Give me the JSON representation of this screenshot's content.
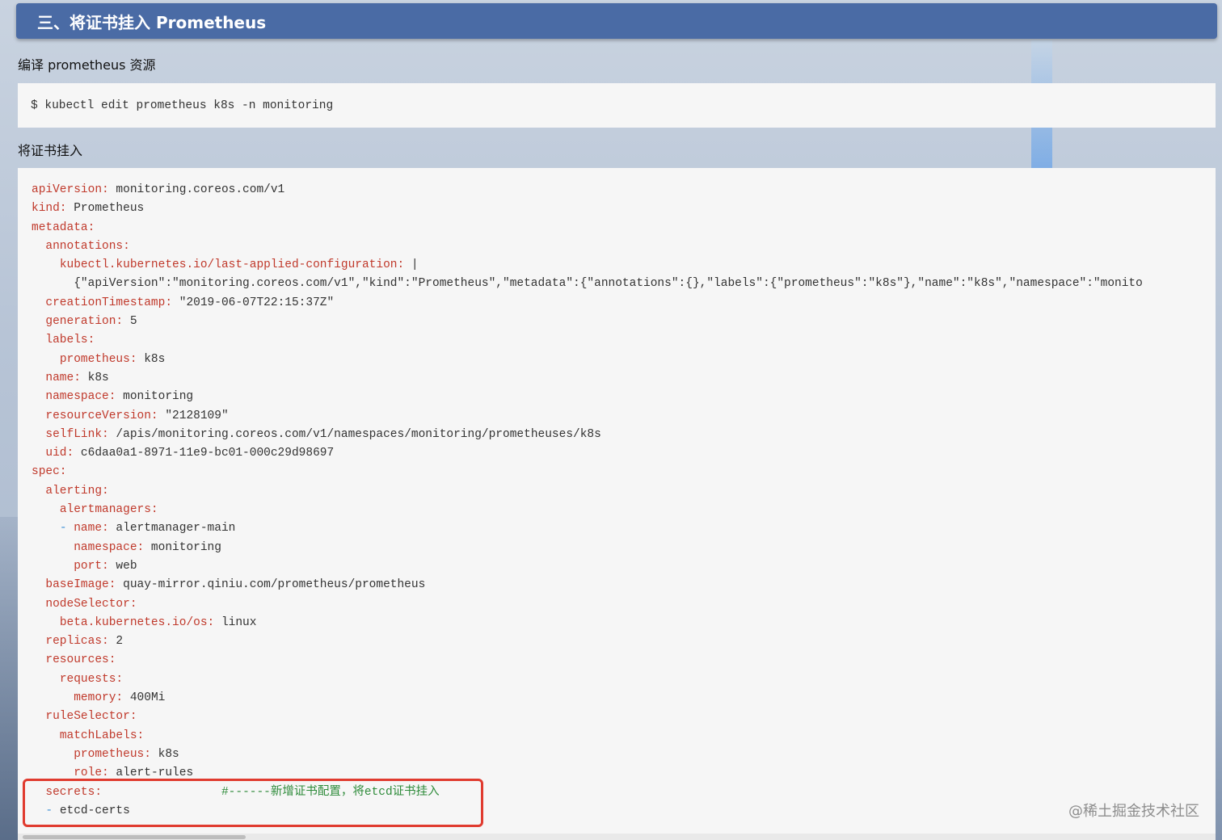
{
  "header": {
    "title": "三、将证书挂入 Prometheus"
  },
  "paragraph1": "编译 prometheus 资源",
  "command": "$ kubectl edit prometheus k8s -n monitoring",
  "paragraph2": "将证书挂入",
  "code_lines": [
    {
      "indent": "",
      "dash": "",
      "key": "apiVersion:",
      "value": " monitoring.coreos.com/v1",
      "comment": ""
    },
    {
      "indent": "",
      "dash": "",
      "key": "kind:",
      "value": " Prometheus",
      "comment": ""
    },
    {
      "indent": "",
      "dash": "",
      "key": "metadata:",
      "value": "",
      "comment": ""
    },
    {
      "indent": "  ",
      "dash": "",
      "key": "annotations:",
      "value": "",
      "comment": ""
    },
    {
      "indent": "    ",
      "dash": "",
      "key": "kubectl.kubernetes.io/last-applied-configuration:",
      "value": " |",
      "comment": ""
    },
    {
      "indent": "      ",
      "dash": "",
      "key": "",
      "value": "{\"apiVersion\":\"monitoring.coreos.com/v1\",\"kind\":\"Prometheus\",\"metadata\":{\"annotations\":{},\"labels\":{\"prometheus\":\"k8s\"},\"name\":\"k8s\",\"namespace\":\"monito",
      "comment": ""
    },
    {
      "indent": "  ",
      "dash": "",
      "key": "creationTimestamp:",
      "value": " \"2019-06-07T22:15:37Z\"",
      "comment": ""
    },
    {
      "indent": "  ",
      "dash": "",
      "key": "generation:",
      "value": " 5",
      "comment": ""
    },
    {
      "indent": "  ",
      "dash": "",
      "key": "labels:",
      "value": "",
      "comment": ""
    },
    {
      "indent": "    ",
      "dash": "",
      "key": "prometheus:",
      "value": " k8s",
      "comment": ""
    },
    {
      "indent": "  ",
      "dash": "",
      "key": "name:",
      "value": " k8s",
      "comment": ""
    },
    {
      "indent": "  ",
      "dash": "",
      "key": "namespace:",
      "value": " monitoring",
      "comment": ""
    },
    {
      "indent": "  ",
      "dash": "",
      "key": "resourceVersion:",
      "value": " \"2128109\"",
      "comment": ""
    },
    {
      "indent": "  ",
      "dash": "",
      "key": "selfLink:",
      "value": " /apis/monitoring.coreos.com/v1/namespaces/monitoring/prometheuses/k8s",
      "comment": ""
    },
    {
      "indent": "  ",
      "dash": "",
      "key": "uid:",
      "value": " c6daa0a1-8971-11e9-bc01-000c29d98697",
      "comment": ""
    },
    {
      "indent": "",
      "dash": "",
      "key": "spec:",
      "value": "",
      "comment": ""
    },
    {
      "indent": "  ",
      "dash": "",
      "key": "alerting:",
      "value": "",
      "comment": ""
    },
    {
      "indent": "    ",
      "dash": "",
      "key": "alertmanagers:",
      "value": "",
      "comment": ""
    },
    {
      "indent": "    ",
      "dash": "- ",
      "key": "name:",
      "value": " alertmanager-main",
      "comment": ""
    },
    {
      "indent": "      ",
      "dash": "",
      "key": "namespace:",
      "value": " monitoring",
      "comment": ""
    },
    {
      "indent": "      ",
      "dash": "",
      "key": "port:",
      "value": " web",
      "comment": ""
    },
    {
      "indent": "  ",
      "dash": "",
      "key": "baseImage:",
      "value": " quay-mirror.qiniu.com/prometheus/prometheus",
      "comment": ""
    },
    {
      "indent": "  ",
      "dash": "",
      "key": "nodeSelector:",
      "value": "",
      "comment": ""
    },
    {
      "indent": "    ",
      "dash": "",
      "key": "beta.kubernetes.io/os:",
      "value": " linux",
      "comment": ""
    },
    {
      "indent": "  ",
      "dash": "",
      "key": "replicas:",
      "value": " 2",
      "comment": ""
    },
    {
      "indent": "  ",
      "dash": "",
      "key": "resources:",
      "value": "",
      "comment": ""
    },
    {
      "indent": "    ",
      "dash": "",
      "key": "requests:",
      "value": "",
      "comment": ""
    },
    {
      "indent": "      ",
      "dash": "",
      "key": "memory:",
      "value": " 400Mi",
      "comment": ""
    },
    {
      "indent": "  ",
      "dash": "",
      "key": "ruleSelector:",
      "value": "",
      "comment": ""
    },
    {
      "indent": "    ",
      "dash": "",
      "key": "matchLabels:",
      "value": "",
      "comment": ""
    },
    {
      "indent": "      ",
      "dash": "",
      "key": "prometheus:",
      "value": " k8s",
      "comment": ""
    },
    {
      "indent": "      ",
      "dash": "",
      "key": "role:",
      "value": " alert-rules",
      "comment": ""
    },
    {
      "indent": "  ",
      "dash": "",
      "key": "secrets:",
      "value": "                 ",
      "comment": "#------新增证书配置，将etcd证书挂入"
    },
    {
      "indent": "  ",
      "dash": "- ",
      "key": "",
      "value": "etcd-certs",
      "comment": ""
    }
  ],
  "watermark": "@稀土掘金技术社区",
  "colors": {
    "header_bg": "#4a6ba5",
    "yaml_key": "#c0392b",
    "comment": "#2e8b3a",
    "highlight_border": "#e03b2f"
  }
}
